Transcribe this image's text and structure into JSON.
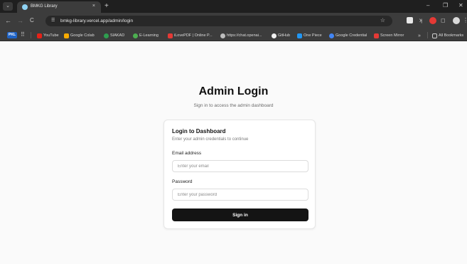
{
  "browser": {
    "tab": {
      "title": "BMKG Library",
      "close": "×"
    },
    "new_tab": "+",
    "window_controls": {
      "minimize": "–",
      "maximize": "❐",
      "close": "✕"
    },
    "nav": {
      "back": "←",
      "forward": "→",
      "reload": "C"
    },
    "address_bar": {
      "url": "bmkg-library.vercel.app/admin/login"
    },
    "bookmarks": [
      {
        "label": "YouTube",
        "icon": "youtube-icon",
        "color": "#e62117"
      },
      {
        "label": "Google Colab",
        "icon": "colab-icon",
        "color": "#f9ab00"
      },
      {
        "label": "SIAKAD",
        "icon": "siakad-icon",
        "color": "#2e9e4f"
      },
      {
        "label": "E-Learning",
        "icon": "elearning-icon",
        "color": "#4caf50"
      },
      {
        "label": "iLovePDF | Online P...",
        "icon": "ilovepdf-icon",
        "color": "#e53935"
      },
      {
        "label": "https://chat.openai...",
        "icon": "openai-icon",
        "color": "#bdbdbd"
      },
      {
        "label": "GitHub",
        "icon": "github-icon",
        "color": "#f0f0f0"
      },
      {
        "label": "One Piece",
        "icon": "onepiece-icon",
        "color": "#2196f3"
      },
      {
        "label": "Google Credential",
        "icon": "google-icon",
        "color": "#4285f4"
      },
      {
        "label": "Screen Mirror",
        "icon": "screen-mirror-icon",
        "color": "#e53935"
      }
    ],
    "bookmarks_overflow": "»",
    "all_bookmarks": "All Bookmarks",
    "first_bookmark": "PKL"
  },
  "page": {
    "title": "Admin Login",
    "subtitle": "Sign in to access the admin dashboard",
    "card": {
      "title": "Login to Dashboard",
      "subtitle": "Enter your admin credentials to continue",
      "email_label": "Email address",
      "email_placeholder": "Enter your email",
      "email_value": "",
      "password_label": "Password",
      "password_placeholder": "Enter your password",
      "password_value": "",
      "submit_label": "Sign in"
    }
  },
  "colors": {
    "accent": "#141414",
    "page_bg": "#fafafa",
    "chrome_bg": "#3c3c3c"
  }
}
